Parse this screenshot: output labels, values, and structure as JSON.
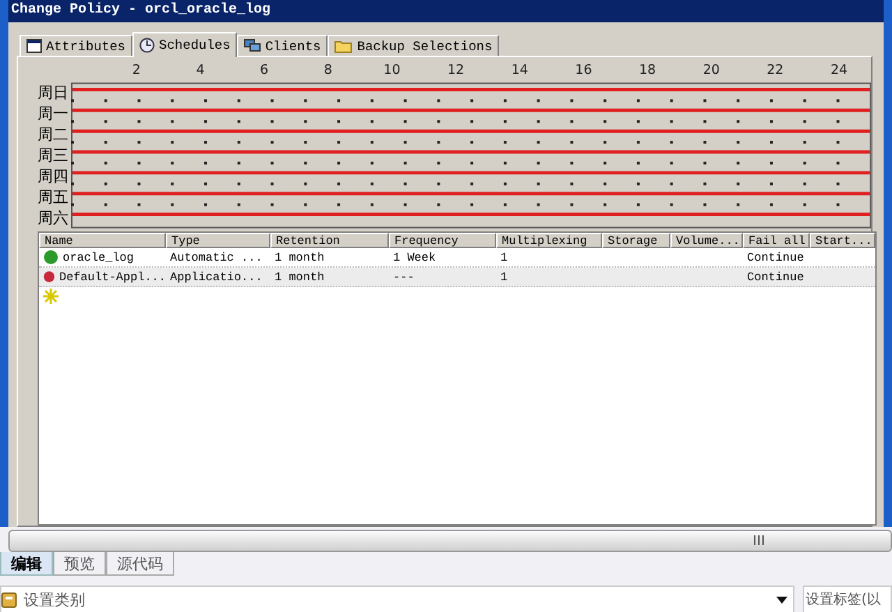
{
  "window": {
    "title": "Change Policy - orcl_oracle_log"
  },
  "tabs": [
    {
      "label": "Attributes",
      "selected": false,
      "kind": "attributes"
    },
    {
      "label": "Schedules",
      "selected": true,
      "kind": "schedules"
    },
    {
      "label": "Clients",
      "selected": false,
      "kind": "clients"
    },
    {
      "label": "Backup Selections",
      "selected": false,
      "kind": "selections"
    }
  ],
  "schedule": {
    "hour_labels": [
      "2",
      "4",
      "6",
      "8",
      "10",
      "12",
      "14",
      "16",
      "18",
      "20",
      "22",
      "24"
    ],
    "days": [
      "周日",
      "周一",
      "周二",
      "周三",
      "周四",
      "周五",
      "周六"
    ]
  },
  "table": {
    "columns": [
      "Name",
      "Type",
      "Retention",
      "Frequency",
      "Multiplexing",
      "Storage",
      "Volume...",
      "Fail all",
      "Start..."
    ],
    "rows": [
      {
        "color": "#2a9a2a",
        "selected": false,
        "cells": [
          "oracle_log",
          "Automatic ...",
          "1 month",
          "1 Week",
          "1",
          "",
          "",
          "Continue",
          ""
        ]
      },
      {
        "color": "#c8283c",
        "selected": true,
        "cells": [
          "Default-Appl...",
          "Applicatio...",
          "1 month",
          "---",
          "1",
          "",
          "",
          "Continue",
          ""
        ]
      }
    ]
  },
  "editor_tabs": [
    {
      "label": "编辑",
      "selected": true
    },
    {
      "label": "预览",
      "selected": false
    },
    {
      "label": "源代码",
      "selected": false
    }
  ],
  "category_field": {
    "placeholder": "设置类别"
  },
  "tag_field": {
    "placeholder": "设置标签(以"
  }
}
